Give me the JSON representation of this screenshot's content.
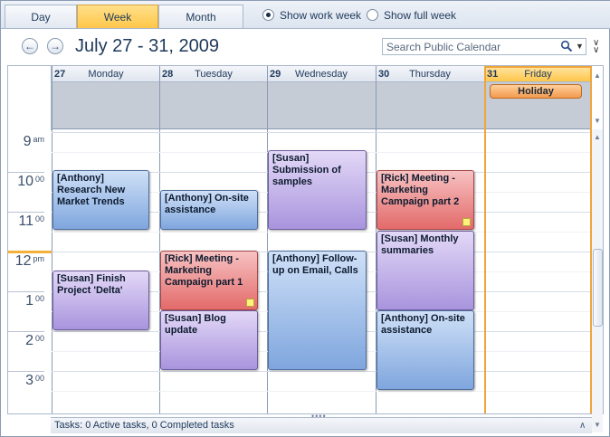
{
  "view_tabs": [
    {
      "label": "Day",
      "active": false
    },
    {
      "label": "Week",
      "active": true
    },
    {
      "label": "Month",
      "active": false
    }
  ],
  "options": {
    "work_week": {
      "label": "Show work week",
      "selected": true
    },
    "full_week": {
      "label": "Show full week",
      "selected": false
    }
  },
  "header": {
    "date_range": "July 27 - 31, 2009",
    "back_icon": "back-arrow-icon",
    "forward_icon": "forward-arrow-icon"
  },
  "search": {
    "placeholder": "Search Public Calendar",
    "icon": "search-icon"
  },
  "days": [
    {
      "num": "27",
      "name": "Monday"
    },
    {
      "num": "28",
      "name": "Tuesday"
    },
    {
      "num": "29",
      "name": "Wednesday"
    },
    {
      "num": "30",
      "name": "Thursday"
    },
    {
      "num": "31",
      "name": "Friday"
    }
  ],
  "all_day": {
    "friday_event": "Holiday"
  },
  "hours": [
    {
      "h": "9",
      "m": "am"
    },
    {
      "h": "10",
      "m": "00"
    },
    {
      "h": "11",
      "m": "00"
    },
    {
      "h": "12",
      "m": "pm"
    },
    {
      "h": "1",
      "m": "00"
    },
    {
      "h": "2",
      "m": "00"
    },
    {
      "h": "3",
      "m": "00"
    }
  ],
  "appointments": {
    "mon1": "[Anthony] Research New Market Trends",
    "mon2": "[Susan] Finish Project 'Delta'",
    "tue1": "[Anthony] On-site assistance",
    "tue2": "[Rick] Meeting - Marketing Campaign part 1",
    "tue3": "[Susan] Blog update",
    "wed1": "[Susan] Submission of samples",
    "wed2": "[Anthony] Follow-up on Email, Calls",
    "thu1": "[Rick] Meeting - Marketing Campaign part 2",
    "thu2": "[Susan] Monthly summaries",
    "thu3": "[Anthony] On-site assistance"
  },
  "tasks_bar": "Tasks: 0 Active tasks, 0 Completed tasks",
  "colors": {
    "accent": "#ffc64a",
    "today_border": "#f0a53a",
    "blue_appt": "#7fa6de",
    "purple_appt": "#a894dd",
    "red_appt": "#e36a6a"
  }
}
